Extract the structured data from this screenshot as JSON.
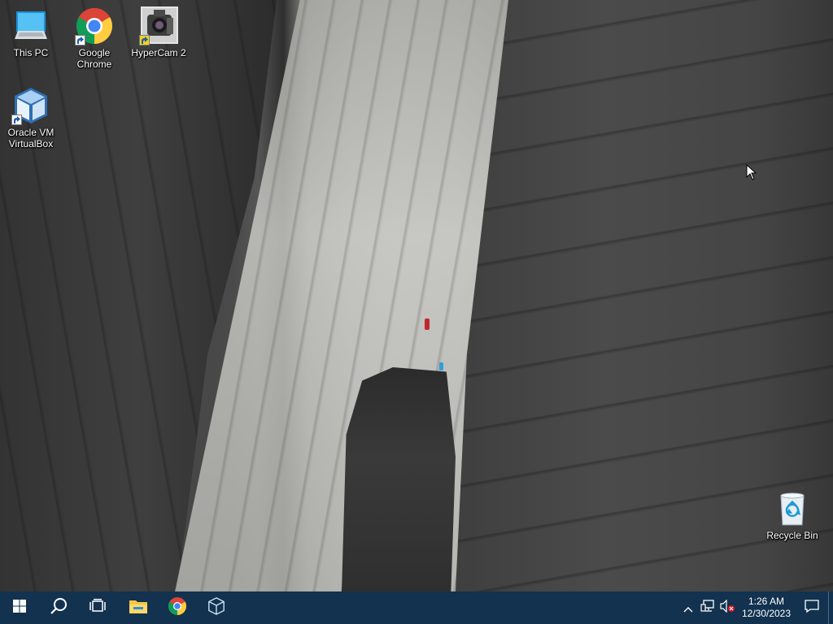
{
  "desktop": {
    "icons": [
      {
        "label": "This PC",
        "icon": "this-pc-icon"
      },
      {
        "label": "Google\nChrome",
        "icon": "chrome-icon"
      },
      {
        "label": "HyperCam 2",
        "icon": "hypercam-icon"
      },
      {
        "label": "Oracle VM\nVirtualBox",
        "icon": "virtualbox-icon"
      },
      {
        "label": "Recycle Bin",
        "icon": "recycle-bin-icon"
      }
    ]
  },
  "taskbar": {
    "start_icon": "windows-start-icon",
    "search_icon": "search-icon",
    "task_view_icon": "task-view-icon",
    "pinned": [
      {
        "icon": "file-explorer-icon"
      },
      {
        "icon": "chrome-icon"
      },
      {
        "icon": "virtualbox-icon"
      }
    ],
    "tray": {
      "show_hidden_icon": "chevron-up-icon",
      "network_icon": "network-icon",
      "volume_icon": "volume-muted-icon",
      "time": "1:26 AM",
      "date": "12/30/2023",
      "notification_icon": "action-center-icon"
    },
    "colors": {
      "taskbar_bg": "#12324f",
      "accent": "#0078d7"
    }
  }
}
